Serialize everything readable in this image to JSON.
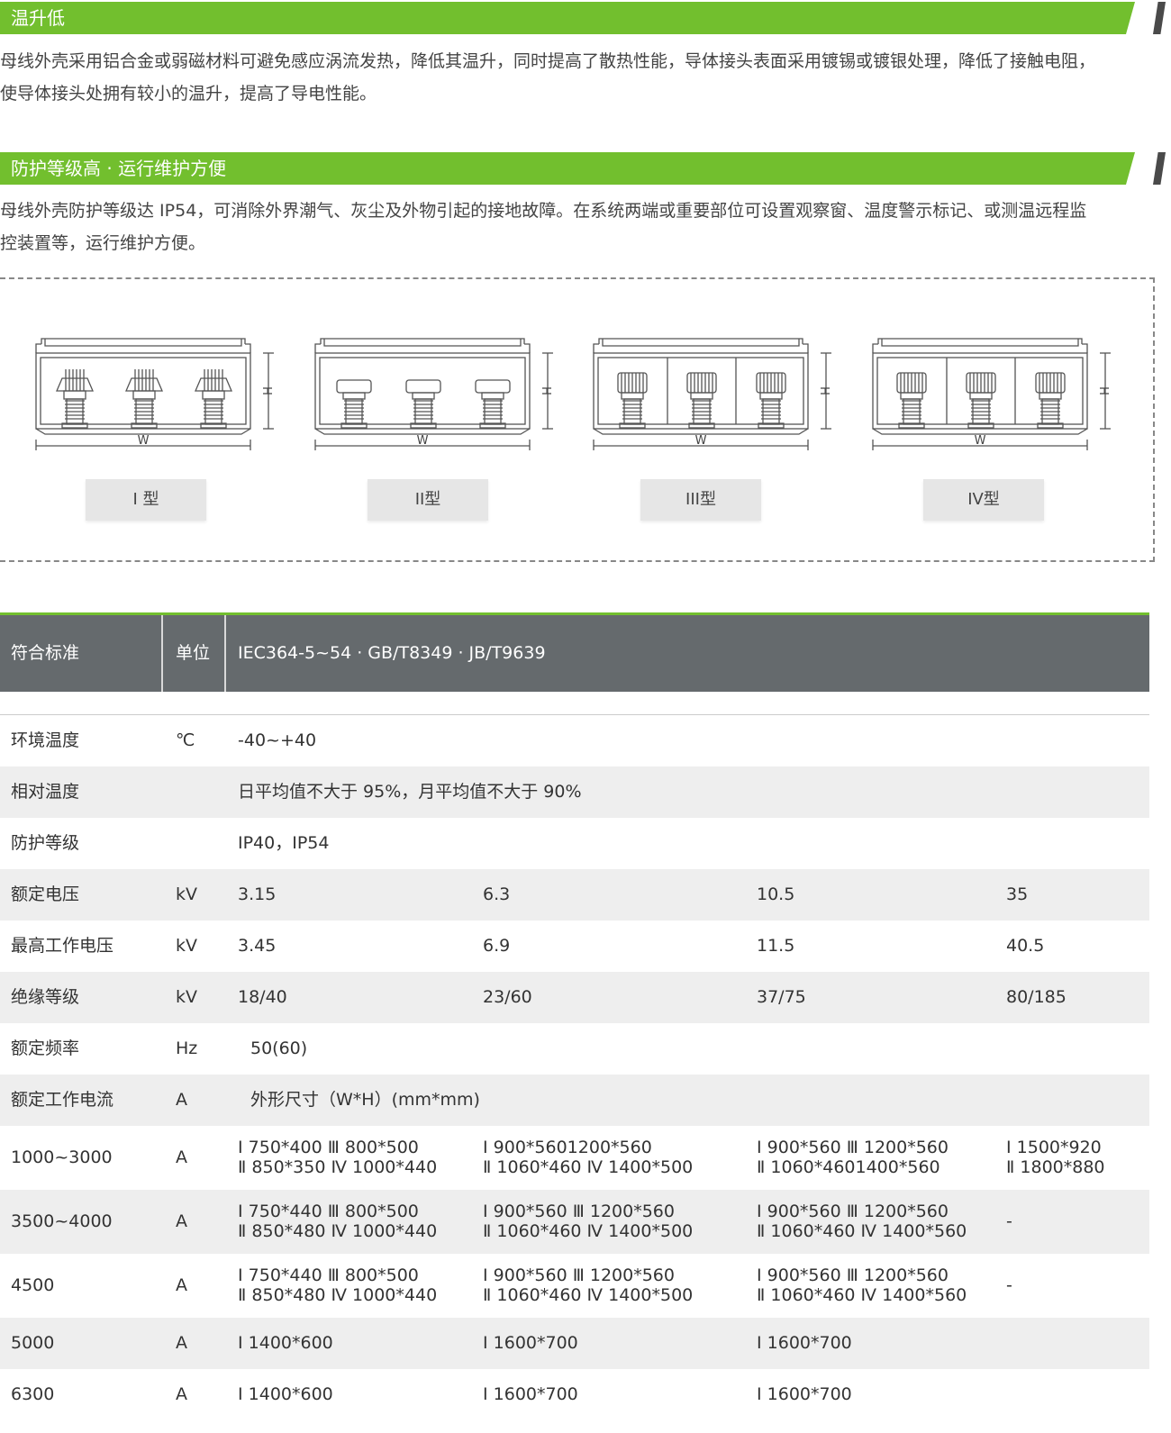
{
  "section1": {
    "title": "温升低",
    "text_line1": "母线外壳采用铝合金或弱磁材料可避免感应涡流发热，降低其温升，同时提高了散热性能，导体接头表面采用镀锡或镀银处理，降低了接触电阻，",
    "text_line2": "使导体接头处拥有较小的温升，提高了导电性能。"
  },
  "section2": {
    "title": "防护等级高 · 运行维护方便",
    "text_line1": "母线外壳防护等级达 IP54，可消除外界潮气、灰尘及外物引起的接地故障。在系统两端或重要部位可设置观察窗、温度警示标记、或测温远程监",
    "text_line2": "控装置等，运行维护方便。"
  },
  "diagram": {
    "dim_w": "W",
    "dim_h": "H",
    "types": [
      "I 型",
      "II型",
      "III型",
      "IV型"
    ]
  },
  "table": {
    "header": [
      "符合标准",
      "单位",
      "IEC364-5~54 · GB/T8349 · JB/T9639"
    ],
    "rows": [
      {
        "name": "环境温度",
        "unit": "℃",
        "v": [
          "-40~+40"
        ]
      },
      {
        "name": "相对温度",
        "unit": "",
        "v": [
          "日平均值不大于 95%，月平均值不大于 90%"
        ]
      },
      {
        "name": "防护等级",
        "unit": "",
        "v": [
          "IP40，IP54"
        ]
      },
      {
        "name": "额定电压",
        "unit": "kV",
        "v": [
          "3.15",
          "6.3",
          "10.5",
          "35"
        ]
      },
      {
        "name": "最高工作电压",
        "unit": "kV",
        "v": [
          "3.45",
          "6.9",
          "11.5",
          "40.5"
        ]
      },
      {
        "name": "绝缘等级",
        "unit": "kV",
        "v": [
          "18/40",
          "23/60",
          "37/75",
          "80/185"
        ]
      },
      {
        "name": "额定频率",
        "unit": "Hz",
        "v": [
          "50(60)"
        ]
      },
      {
        "name": "额定工作电流",
        "unit": "A",
        "v": [
          "外形尺寸（W*H）(mm*mm)"
        ]
      },
      {
        "name": "1000~3000",
        "unit": "A",
        "v": [
          [
            "Ⅰ 750*400 Ⅲ 800*500",
            "Ⅱ 850*350 Ⅳ 1000*440"
          ],
          [
            "Ⅰ 900*5601200*560",
            "Ⅱ 1060*460 Ⅳ 1400*500"
          ],
          [
            "Ⅰ 900*560 Ⅲ 1200*560",
            "Ⅱ 1060*4601400*560"
          ],
          [
            "Ⅰ 1500*920",
            "Ⅱ 1800*880"
          ]
        ]
      },
      {
        "name": "3500~4000",
        "unit": "A",
        "v": [
          [
            "Ⅰ 750*440 Ⅲ 800*500",
            "Ⅱ 850*480 Ⅳ 1000*440"
          ],
          [
            "Ⅰ 900*560 Ⅲ 1200*560",
            "Ⅱ 1060*460 Ⅳ 1400*500"
          ],
          [
            "Ⅰ 900*560 Ⅲ 1200*560",
            "Ⅱ 1060*460 Ⅳ 1400*560"
          ],
          [
            "-"
          ]
        ]
      },
      {
        "name": "4500",
        "unit": "A",
        "v": [
          [
            "Ⅰ 750*440 Ⅲ 800*500",
            "Ⅱ 850*480 Ⅳ 1000*440"
          ],
          [
            "Ⅰ 900*560 Ⅲ 1200*560",
            "Ⅱ 1060*460 Ⅳ 1400*500"
          ],
          [
            "Ⅰ 900*560 Ⅲ 1200*560",
            "Ⅱ 1060*460 Ⅳ 1400*560"
          ],
          [
            "-"
          ]
        ]
      },
      {
        "name": "5000",
        "unit": "A",
        "v": [
          "Ⅰ 1400*600",
          "Ⅰ 1600*700",
          "Ⅰ 1600*700"
        ]
      },
      {
        "name": "6300",
        "unit": "A",
        "v": [
          "Ⅰ 1400*600",
          "Ⅰ 1600*700",
          "Ⅰ 1600*700"
        ]
      }
    ]
  },
  "colors": {
    "accent": "#72bf2e",
    "header_bg": "#656a6d",
    "row_alt": "#eeeeee"
  }
}
